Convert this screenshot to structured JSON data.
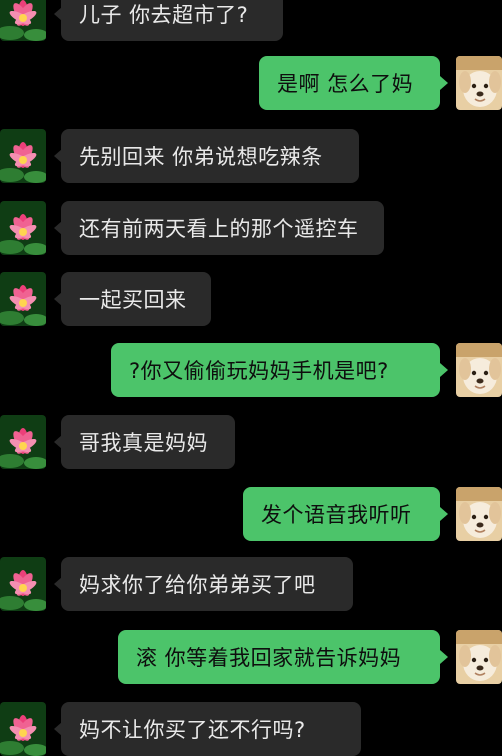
{
  "theme": {
    "background": "#000000",
    "incoming_bubble": "#2a2a2a",
    "outgoing_bubble": "#4cc46a",
    "incoming_text": "#e9e9e9",
    "outgoing_text": "#0e0e0e"
  },
  "avatars": {
    "contact": "lotus-flower-avatar",
    "me": "puppy-photo-avatar"
  },
  "messages": [
    {
      "sender": "contact",
      "text": "儿子 你去超市了?"
    },
    {
      "sender": "me",
      "text": "是啊 怎么了妈"
    },
    {
      "sender": "contact",
      "text": "先别回来 你弟说想吃辣条"
    },
    {
      "sender": "contact",
      "text": "还有前两天看上的那个遥控车"
    },
    {
      "sender": "contact",
      "text": "一起买回来"
    },
    {
      "sender": "me",
      "text": "?你又偷偷玩妈妈手机是吧?"
    },
    {
      "sender": "contact",
      "text": "哥我真是妈妈"
    },
    {
      "sender": "me",
      "text": "发个语音我听听"
    },
    {
      "sender": "contact",
      "text": "妈求你了给你弟弟买了吧"
    },
    {
      "sender": "me",
      "text": "滚 你等着我回家就告诉妈妈"
    },
    {
      "sender": "contact",
      "text": "妈不让你买了还不行吗?"
    }
  ]
}
